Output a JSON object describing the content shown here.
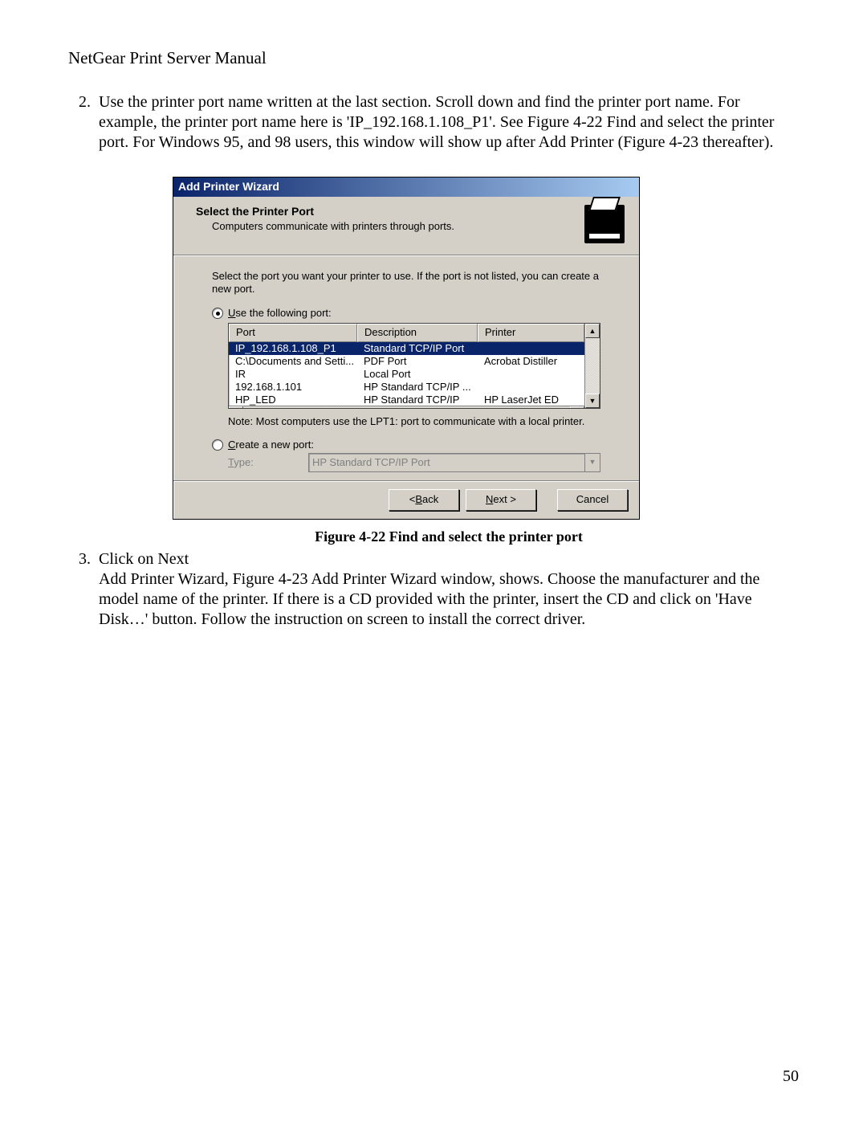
{
  "doc_title": "NetGear Print Server Manual",
  "step2_num": "2.",
  "step2_text": "Use the printer port name written at the last section. Scroll down and find the printer port name. For example, the printer port name here is 'IP_192.168.1.108_P1'. See Figure 4-22 Find and select the printer port. For Windows 95, and 98 users, this window will show up after Add Printer (Figure 4-23 thereafter).",
  "caption": "Figure 4-22 Find and select the printer port",
  "step3_num": "3.",
  "step3_lead": "Click on Next",
  "step3_text": "Add Printer Wizard, Figure 4-23 Add Printer Wizard window, shows. Choose the manufacturer and the model name of the printer. If there is a CD provided with the printer, insert the CD and click on 'Have Disk…' button. Follow the instruction on screen to install the correct driver.",
  "page_number": "50",
  "dialog": {
    "title": "Add Printer Wizard",
    "header_title": "Select the Printer Port",
    "header_sub": "Computers communicate with printers through ports.",
    "instruction": "Select the port you want your printer to use.  If the port is not listed, you can create a new port.",
    "radio_use_pre": "U",
    "radio_use_rest": "se the following port:",
    "radio_new_pre": "C",
    "radio_new_rest": "reate a new port:",
    "type_label_pre": "T",
    "type_label_rest": "ype:",
    "type_value": "HP Standard TCP/IP Port",
    "note": "Note: Most computers use the LPT1: port to communicate with a local printer.",
    "columns": {
      "port": "Port",
      "desc": "Description",
      "printer": "Printer"
    },
    "rows": [
      {
        "port": "IP_192.168.1.108_P1",
        "desc": "Standard TCP/IP Port",
        "printer": "",
        "selected": true
      },
      {
        "port": "C:\\Documents and Setti...",
        "desc": "PDF Port",
        "printer": "Acrobat Distiller"
      },
      {
        "port": "IR",
        "desc": "Local Port",
        "printer": ""
      },
      {
        "port": "192.168.1.101",
        "desc": "HP Standard TCP/IP ...",
        "printer": ""
      },
      {
        "port": "HP_LED",
        "desc": "HP Standard TCP/IP",
        "printer": "HP LaserJet ED",
        "cut": true
      }
    ],
    "buttons": {
      "back_pre": "< ",
      "back_m": "B",
      "back_rest": "ack",
      "next_m": "N",
      "next_rest": "ext >",
      "cancel": "Cancel"
    }
  }
}
